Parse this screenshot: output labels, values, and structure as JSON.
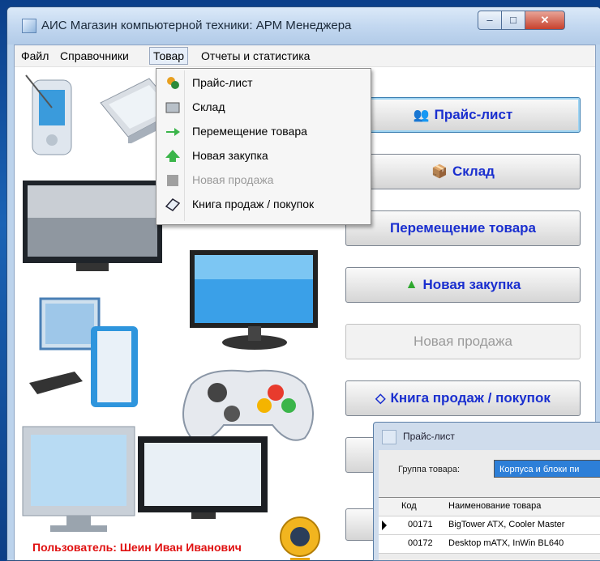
{
  "window": {
    "title": "АИС Магазин компьютерной техники: АРМ Менеджера",
    "buttons": {
      "minimize": "–",
      "maximize": "□",
      "close": "✕"
    }
  },
  "menubar": {
    "items": [
      "Файл",
      "Справочники",
      "Товар",
      "Отчеты и статистика"
    ],
    "active": "Товар"
  },
  "dropdown": {
    "items": [
      {
        "label": "Прайс-лист",
        "icon": "price-list-icon",
        "enabled": true
      },
      {
        "label": "Склад",
        "icon": "warehouse-icon",
        "enabled": true
      },
      {
        "label": "Перемещение товара",
        "icon": "arrow-right-icon",
        "enabled": true
      },
      {
        "label": "Новая закупка",
        "icon": "purchase-icon",
        "enabled": true
      },
      {
        "label": "Новая продажа",
        "icon": "sale-icon",
        "enabled": false
      },
      {
        "label": "Книга продаж / покупок",
        "icon": "book-icon",
        "enabled": true
      }
    ]
  },
  "buttons": [
    {
      "label": "Прайс-лист",
      "icon": "price-list-icon",
      "enabled": true,
      "focused": true
    },
    {
      "label": "Склад",
      "icon": "warehouse-icon",
      "enabled": true
    },
    {
      "label": "Перемещение товара",
      "icon": "",
      "enabled": true
    },
    {
      "label": "Новая закупка",
      "icon": "purchase-icon",
      "enabled": true
    },
    {
      "label": "Новая продажа",
      "icon": "",
      "enabled": false
    },
    {
      "label": "Книга продаж / покупок",
      "icon": "book-icon",
      "enabled": true
    }
  ],
  "user_label": "Пользователь: Шеин Иван Иванович",
  "price_window": {
    "title": "Прайс-лист",
    "group_label": "Группа товара:",
    "group_value": "Корпуса и блоки пи",
    "columns": [
      "Код",
      "Наименование товара"
    ],
    "rows": [
      {
        "code": "00171",
        "name": "BigTower ATX, Cooler Master"
      },
      {
        "code": "00172",
        "name": "Desktop mATX, InWin BL640"
      }
    ]
  },
  "colors": {
    "button_text": "#1a2fcf",
    "user_text": "#e01010",
    "selection": "#2d7fd8"
  }
}
